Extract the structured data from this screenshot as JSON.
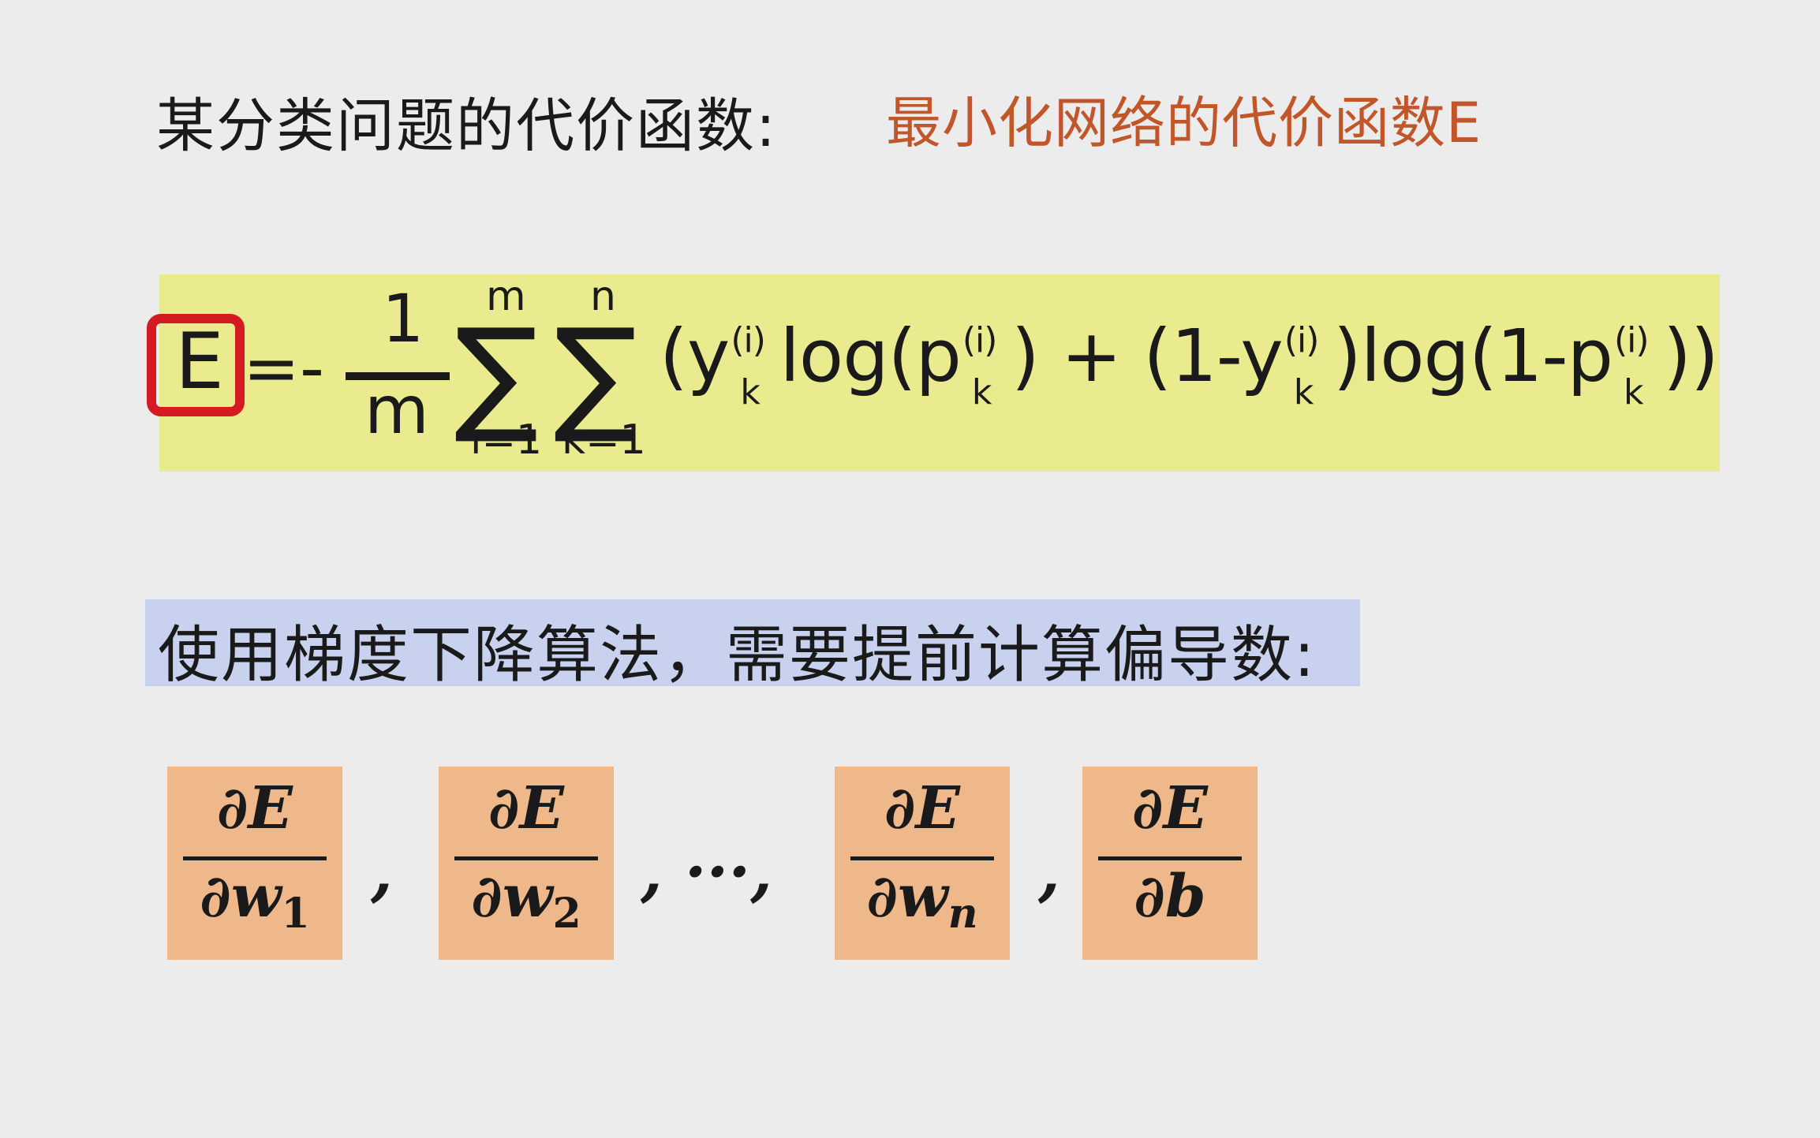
{
  "title": {
    "main": "某分类问题的代价函数:",
    "accent": "最小化网络的代价函数E"
  },
  "formula": {
    "lhs": "E",
    "equals_minus": "=-",
    "frac_num": "1",
    "frac_den": "m",
    "sum1_upper": "m",
    "sum1_lower": "i=1",
    "sum2_upper": "n",
    "sum2_lower": "k=1",
    "sigma": "∑",
    "p1": "(y",
    "p2": "log(p",
    "p3": ") + (1-y",
    "p4": ")log(1-p",
    "p5": "))",
    "sup_i": "(i)",
    "sub_k": "k"
  },
  "subtitle": "使用梯度下降算法，需要提前计算偏导数:",
  "partials": {
    "numerator": "∂E",
    "d": "∂",
    "w": "w",
    "sub1": "1",
    "sub2": "2",
    "subn": "n",
    "b": "∂b",
    "comma": ",",
    "ellipsis": ", ···,"
  },
  "colors": {
    "background": "#ececec",
    "accent_text": "#c0562a",
    "formula_highlight": "#eaeb8e",
    "e_box_border": "#d51b22",
    "subtitle_highlight": "#c8d2ee",
    "partial_box": "#efb88a"
  }
}
